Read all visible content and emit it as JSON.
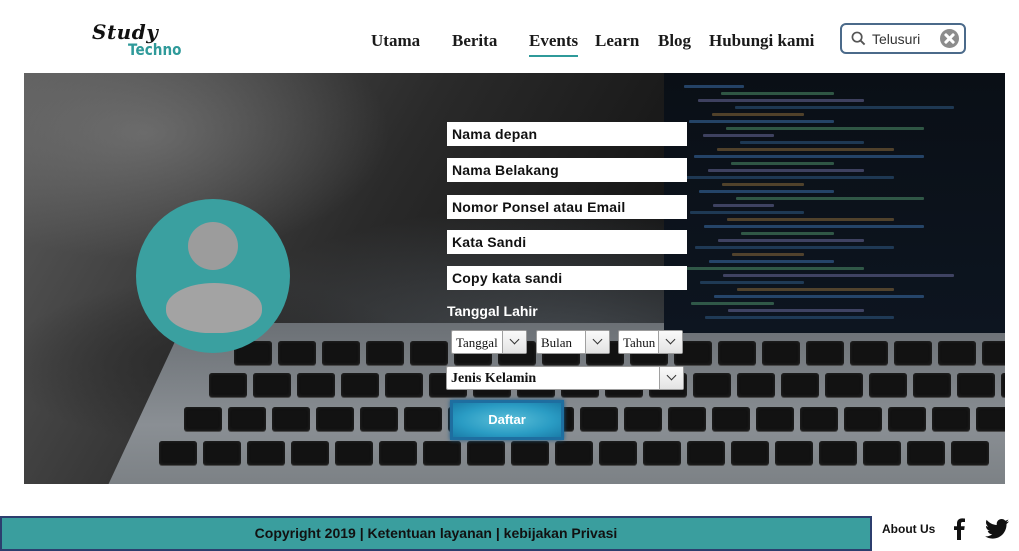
{
  "brand": {
    "line1": "Study",
    "line2": "Techno"
  },
  "nav": {
    "items": [
      {
        "label": "Utama"
      },
      {
        "label": "Berita"
      },
      {
        "label": "Events"
      },
      {
        "label": "Learn"
      },
      {
        "label": "Blog"
      },
      {
        "label": "Hubungi kami"
      }
    ],
    "active": "Events"
  },
  "search": {
    "value": "Telusuri"
  },
  "form": {
    "first_name": "Nama depan",
    "last_name": "Nama Belakang",
    "phone_email": "Nomor Ponsel atau Email",
    "password": "Kata Sandi",
    "confirm_password": "Copy kata sandi",
    "dob_label": "Tanggal Lahir",
    "dob_day": "Tanggal",
    "dob_month": "Bulan",
    "dob_year": "Tahun",
    "gender": "Jenis Kelamin",
    "submit": "Daftar"
  },
  "footer": {
    "copyright": "Copyright 2019 | Ketentuan layanan | kebijakan Privasi",
    "about": "About Us"
  },
  "colors": {
    "accent": "#3a9e9e",
    "button": "#2a9cc4",
    "footer_border": "#2c3e6e"
  },
  "icons": [
    "search-icon",
    "clear-icon",
    "avatar-icon",
    "facebook-icon",
    "twitter-icon"
  ]
}
